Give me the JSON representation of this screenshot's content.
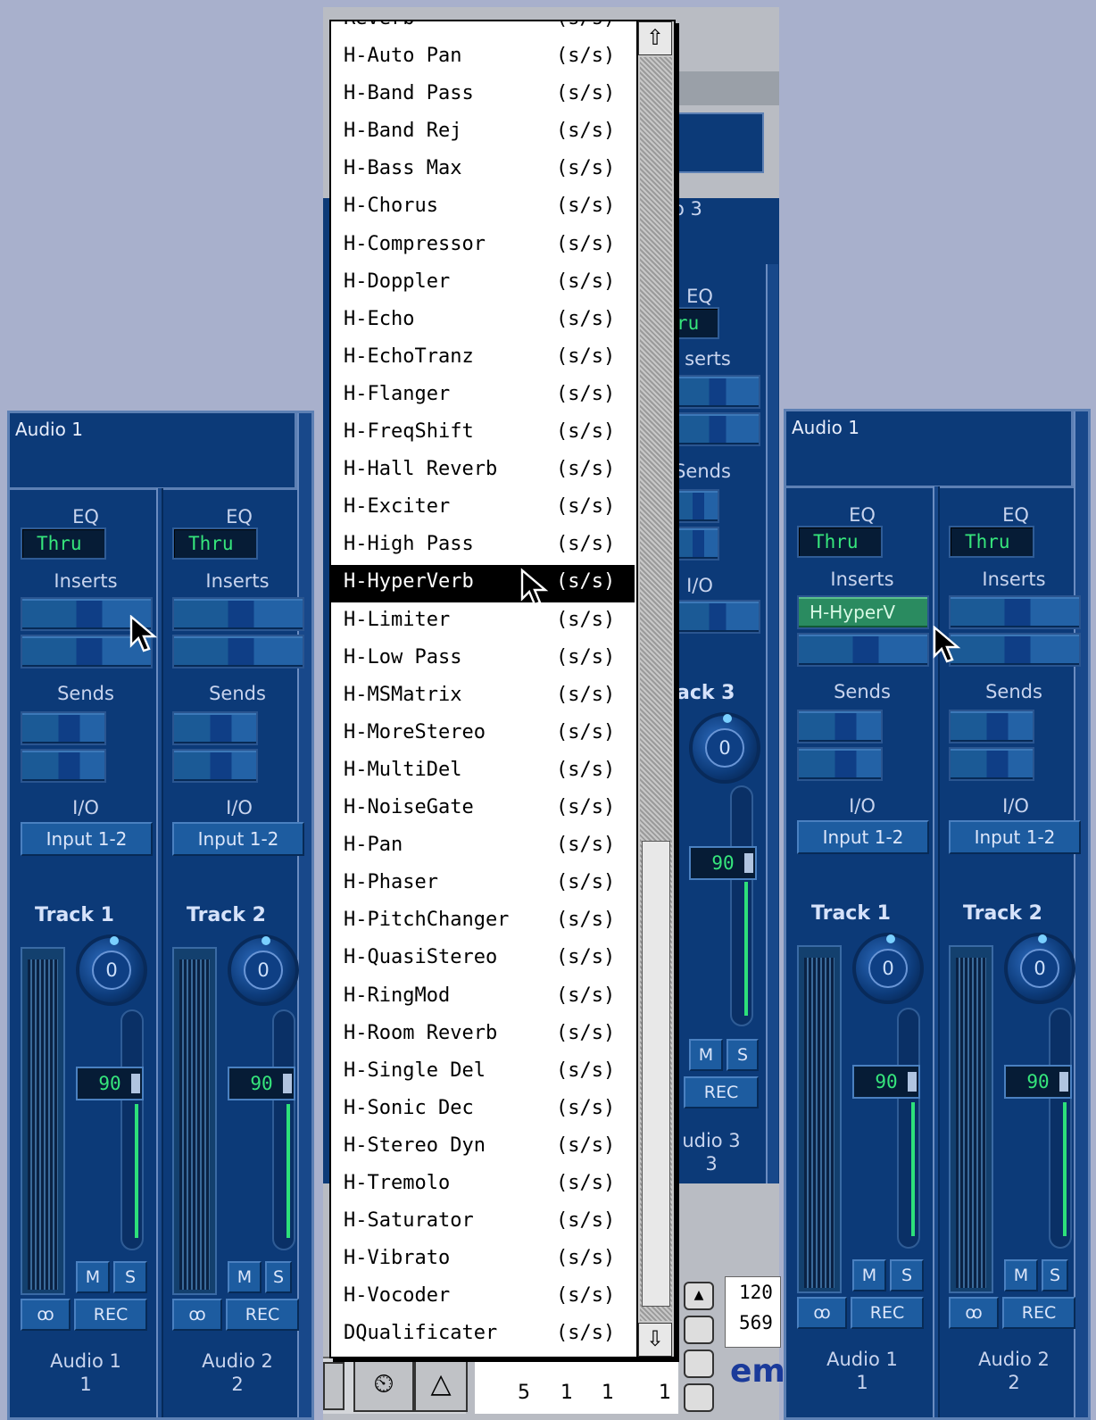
{
  "left_panel": {
    "title": "Audio 1",
    "strips": [
      {
        "eq_label": "EQ",
        "eq_value": "Thru",
        "inserts_label": "Inserts",
        "sends_label": "Sends",
        "io_label": "I/O",
        "io_value": "Input 1-2",
        "track_label": "Track 1",
        "pan_value": "0",
        "fader_value": "90",
        "mute": "M",
        "solo": "S",
        "link": "ꝏ",
        "rec": "REC",
        "name": "Audio 1",
        "number": "1"
      },
      {
        "eq_label": "EQ",
        "eq_value": "Thru",
        "inserts_label": "Inserts",
        "sends_label": "Sends",
        "io_label": "I/O",
        "io_value": "Input 1-2",
        "track_label": "Track 2",
        "pan_value": "0",
        "fader_value": "90",
        "mute": "M",
        "solo": "S",
        "link": "ꝏ",
        "rec": "REC",
        "name": "Audio 2",
        "number": "2"
      }
    ]
  },
  "right_panel": {
    "title": "Audio 1",
    "insert_plugin": "H-HyperV",
    "strips": [
      {
        "eq_label": "EQ",
        "eq_value": "Thru",
        "inserts_label": "Inserts",
        "sends_label": "Sends",
        "io_label": "I/O",
        "io_value": "Input 1-2",
        "track_label": "Track 1",
        "pan_value": "0",
        "fader_value": "90",
        "mute": "M",
        "solo": "S",
        "link": "ꝏ",
        "rec": "REC",
        "name": "Audio 1",
        "number": "1"
      },
      {
        "eq_label": "EQ",
        "eq_value": "Thru",
        "inserts_label": "Inserts",
        "sends_label": "Sends",
        "io_label": "I/O",
        "io_value": "Input 1-2",
        "track_label": "Track 2",
        "pan_value": "0",
        "fader_value": "90",
        "mute": "M",
        "solo": "S",
        "link": "ꝏ",
        "rec": "REC",
        "name": "Audio 2",
        "number": "2"
      }
    ]
  },
  "background_strip": {
    "frag_title": "o 3",
    "eq_label": "EQ",
    "eq_value": "ru",
    "inserts_label": "serts",
    "sends_label": "Sends",
    "io_label": "I/O",
    "track_label": "ack 3",
    "pan_value": "0",
    "fader_value": "90",
    "mute": "M",
    "solo": "S",
    "rec": "REC",
    "name": "udio 3",
    "number": "3",
    "counter_top": "120",
    "counter_bottom": "569",
    "logo_frag": "em",
    "ruler": [
      "5",
      "1",
      "1",
      "1"
    ]
  },
  "popup_menu": {
    "partial_top_item": "Reverb",
    "partial_top_tag": "(s/s)",
    "selected_index": 14,
    "items": [
      {
        "name": "H-Auto Pan",
        "tag": "(s/s)"
      },
      {
        "name": "H-Band Pass",
        "tag": "(s/s)"
      },
      {
        "name": "H-Band Rej",
        "tag": "(s/s)"
      },
      {
        "name": "H-Bass Max",
        "tag": "(s/s)"
      },
      {
        "name": "H-Chorus",
        "tag": "(s/s)"
      },
      {
        "name": "H-Compressor",
        "tag": "(s/s)"
      },
      {
        "name": "H-Doppler",
        "tag": "(s/s)"
      },
      {
        "name": "H-Echo",
        "tag": "(s/s)"
      },
      {
        "name": "H-EchoTranz",
        "tag": "(s/s)"
      },
      {
        "name": "H-Flanger",
        "tag": "(s/s)"
      },
      {
        "name": "H-FreqShift",
        "tag": "(s/s)"
      },
      {
        "name": "H-Hall Reverb",
        "tag": "(s/s)"
      },
      {
        "name": "H-Exciter",
        "tag": "(s/s)"
      },
      {
        "name": "H-High Pass",
        "tag": "(s/s)"
      },
      {
        "name": "H-HyperVerb",
        "tag": "(s/s)"
      },
      {
        "name": "H-Limiter",
        "tag": "(s/s)"
      },
      {
        "name": "H-Low Pass",
        "tag": "(s/s)"
      },
      {
        "name": "H-MSMatrix",
        "tag": "(s/s)"
      },
      {
        "name": "H-MoreStereo",
        "tag": "(s/s)"
      },
      {
        "name": "H-MultiDel",
        "tag": "(s/s)"
      },
      {
        "name": "H-NoiseGate",
        "tag": "(s/s)"
      },
      {
        "name": "H-Pan",
        "tag": "(s/s)"
      },
      {
        "name": "H-Phaser",
        "tag": "(s/s)"
      },
      {
        "name": "H-PitchChanger",
        "tag": "(s/s)"
      },
      {
        "name": "H-QuasiStereo",
        "tag": "(s/s)"
      },
      {
        "name": "H-RingMod",
        "tag": "(s/s)"
      },
      {
        "name": "H-Room Reverb",
        "tag": "(s/s)"
      },
      {
        "name": "H-Single Del",
        "tag": "(s/s)"
      },
      {
        "name": "H-Sonic Dec",
        "tag": "(s/s)"
      },
      {
        "name": "H-Stereo Dyn",
        "tag": "(s/s)"
      },
      {
        "name": "H-Tremolo",
        "tag": "(s/s)"
      },
      {
        "name": "H-Saturator",
        "tag": "(s/s)"
      },
      {
        "name": "H-Vibrato",
        "tag": "(s/s)"
      },
      {
        "name": "H-Vocoder",
        "tag": "(s/s)"
      },
      {
        "name": "DQualificater",
        "tag": "(s/s)"
      }
    ],
    "scroll_up_icon": "arrow-up-icon",
    "scroll_down_icon": "arrow-down-icon"
  },
  "colors": {
    "panel": "#0c3a78",
    "lcd_text": "#36e67c",
    "menu_bg": "#ffffff",
    "selected_bg": "#000000"
  }
}
